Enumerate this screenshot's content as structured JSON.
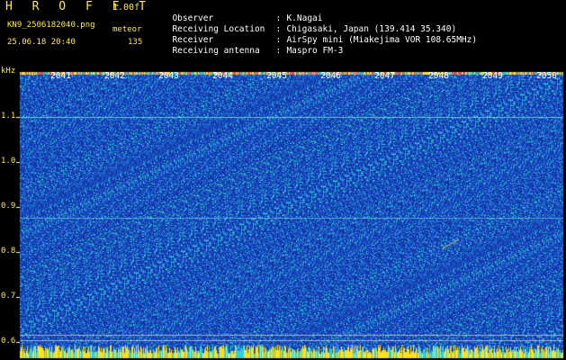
{
  "header": {
    "app_title": "H R O F F T",
    "version": "1.00f",
    "filename": "KN9_2506182040.png",
    "meteor_label": "meteor",
    "datetime": "25.06.18 20:40",
    "meteor_count": "135"
  },
  "meta": [
    {
      "key": "Observer",
      "value": "K.Nagai"
    },
    {
      "key": "Receiving Location",
      "value": "Chigasaki, Japan (139.414 35.340)"
    },
    {
      "key": "Receiver",
      "value": "AirSpy mini (Miakejima VOR 108.65MHz)"
    },
    {
      "key": "Receiving antenna",
      "value": "Maspro FM-3"
    }
  ],
  "axis": {
    "unit": "kHz",
    "y_ticks": [
      "1.1",
      "1.0",
      "0.9",
      "0.8",
      "0.7",
      "0.6"
    ],
    "time_ticks": [
      "2041",
      "2042",
      "2043",
      "2044",
      "2045",
      "2046",
      "2047",
      "2048",
      "2049",
      "2050"
    ]
  },
  "colors": {
    "label_yellow": "#ffe94a",
    "background_blue": "#1f3aa8"
  }
}
